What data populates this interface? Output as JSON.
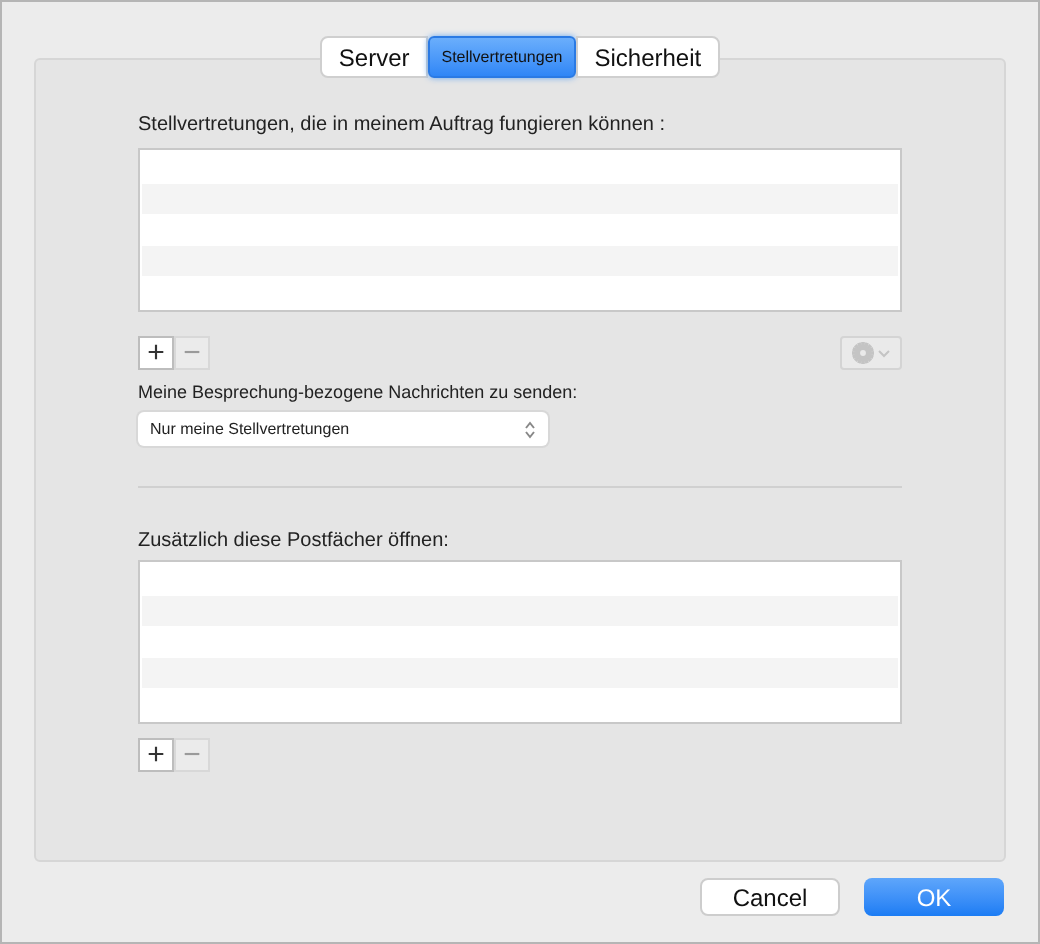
{
  "tabs": [
    {
      "label": "Server",
      "selected": false
    },
    {
      "label": "Stellvertretungen",
      "selected": true
    },
    {
      "label": "Sicherheit",
      "selected": false
    }
  ],
  "delegates": {
    "label": "Stellvertretungen, die in meinem Auftrag fungieren können :",
    "add": {
      "label": "+",
      "disabled": false
    },
    "remove": {
      "label": "−",
      "disabled": true
    },
    "gear": {
      "disabled": true
    }
  },
  "meeting": {
    "label": "Meine Besprechung-bezogene Nachrichten zu senden:",
    "value": "Nur meine Stellvertretungen"
  },
  "mailboxes": {
    "label": "Zusätzlich diese Postfächer öffnen:",
    "add": {
      "label": "+",
      "disabled": false
    },
    "remove": {
      "label": "−",
      "disabled": true
    }
  },
  "buttons": [
    {
      "label": "Cancel",
      "kind": "secondary"
    },
    {
      "label": "OK",
      "kind": "primary"
    }
  ]
}
